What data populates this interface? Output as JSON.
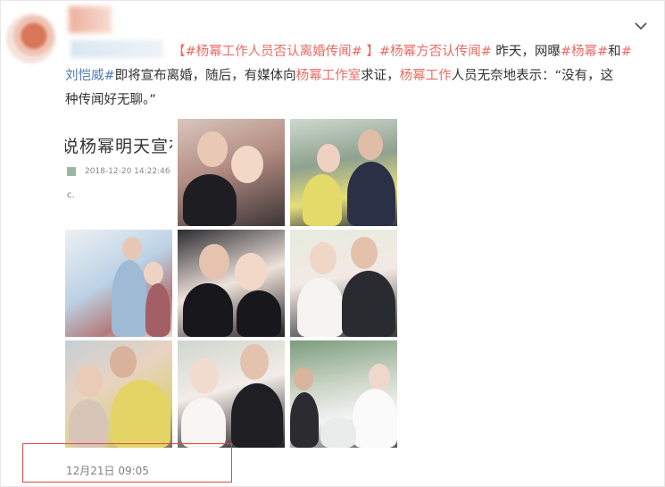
{
  "post": {
    "topic_tag": "【#杨幂工作人员否认离婚传闻# 】",
    "tag_denies": "#杨幂方否认传闻#",
    "text_1": " 昨天，网曝",
    "tag_yangmi": "#杨幂#",
    "text_and": "和",
    "tag_liu_hash": "#",
    "tag_liu": "刘恺威#",
    "text_2": "即将宣布离婚，随后，有媒体向",
    "hl_studio": "杨幂工作室",
    "text_3": "求证，",
    "hl_staff": "杨幂工作",
    "text_4": "人员无奈地表示：“没有，这",
    "text_5": "种传闻好无聊。”"
  },
  "photos": {
    "first": {
      "headline": "说杨幂明天宣布离",
      "date": "2018-12-20 14:22:46",
      "dot": "c."
    }
  },
  "timestamp": "12月21日 09:05",
  "icons": {
    "expand": "chevron-down-icon"
  },
  "colors": {
    "tag": "#eb6b65",
    "highlight_box": "#e04848",
    "blue_link": "#4e7bb2"
  }
}
